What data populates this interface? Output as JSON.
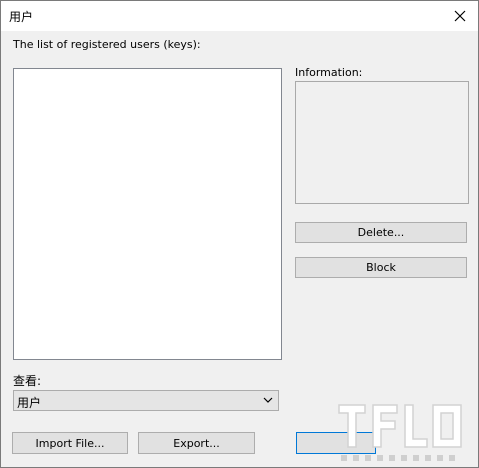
{
  "window": {
    "title": "用户"
  },
  "users_list": {
    "label": "The list of registered users (keys):",
    "items": []
  },
  "info": {
    "label": "Information:"
  },
  "buttons": {
    "delete": "Delete...",
    "block": "Block",
    "import": "Import File...",
    "export": "Export..."
  },
  "view": {
    "label": "查看:",
    "selected": "用户"
  },
  "icons": {
    "close": "close-icon",
    "dropdown": "chevron-down-icon",
    "watermark": "watermark-logo"
  },
  "colors": {
    "focus_border": "#0078d7",
    "dialog_bg": "#f0f0f0",
    "titlebar_bg": "#ffffff"
  }
}
